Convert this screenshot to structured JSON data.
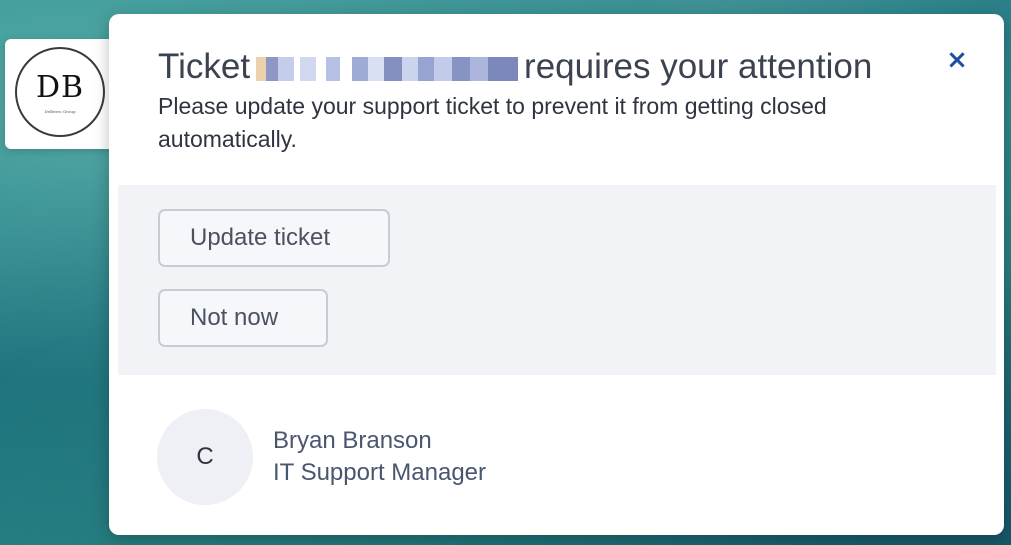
{
  "logo": {
    "initials": "DB",
    "subtext": "DeBerro Group"
  },
  "notification": {
    "title_prefix": "Ticket",
    "title_suffix": "requires your attention",
    "message": "Please update your support ticket to prevent it from getting closed automatically.",
    "close_icon": "close-icon",
    "close_glyph": "×",
    "accent_color": "#1b4fa0"
  },
  "actions": {
    "update_label": "Update ticket",
    "later_label": "Not now"
  },
  "sender": {
    "avatar_initial": "C",
    "name": "Bryan Branson",
    "role": "IT Support Manager"
  }
}
